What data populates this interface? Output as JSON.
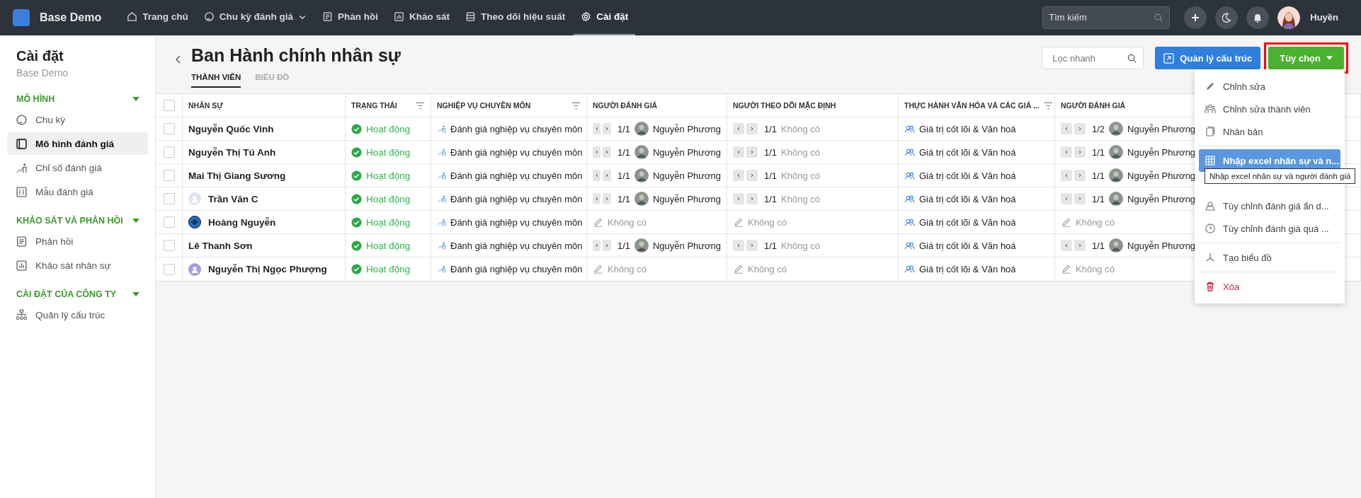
{
  "topbar": {
    "brand": "Base Demo",
    "nav": [
      {
        "label": "Trang chủ",
        "selected": false,
        "dropdown": false
      },
      {
        "label": "Chu kỳ đánh giá",
        "selected": false,
        "dropdown": true
      },
      {
        "label": "Phản hồi",
        "selected": false,
        "dropdown": false
      },
      {
        "label": "Khảo sát",
        "selected": false,
        "dropdown": false
      },
      {
        "label": "Theo dõi hiệu suất",
        "selected": false,
        "dropdown": false
      },
      {
        "label": "Cài đặt",
        "selected": true,
        "dropdown": false
      }
    ],
    "search": {
      "placeholder": "Tìm kiếm"
    },
    "user": "Huyền"
  },
  "sidebar": {
    "title": "Cài đặt",
    "subtitle": "Base Demo",
    "sections": [
      {
        "title": "MÔ HÌNH",
        "expanded": true,
        "items": [
          {
            "label": "Chu kỳ",
            "selected": false
          },
          {
            "label": "Mô hình đánh giá",
            "selected": true
          },
          {
            "label": "Chỉ số đánh giá",
            "selected": false
          },
          {
            "label": "Mẫu đánh giá",
            "selected": false
          }
        ]
      },
      {
        "title": "KHẢO SÁT VÀ PHẢN HỒI",
        "expanded": true,
        "items": [
          {
            "label": "Phản hồi",
            "selected": false
          },
          {
            "label": "Khảo sát nhân sự",
            "selected": false
          }
        ]
      },
      {
        "title": "CÀI ĐẶT CỦA CÔNG TY",
        "expanded": true,
        "items": [
          {
            "label": "Quản lý cấu trúc",
            "selected": false
          }
        ]
      }
    ]
  },
  "page": {
    "title": "Ban Hành chính nhân sự",
    "tabs": [
      {
        "label": "THÀNH VIÊN",
        "selected": true
      },
      {
        "label": "BIỂU ĐỒ",
        "selected": false
      }
    ],
    "filter": {
      "placeholder": "Lọc nhanh"
    },
    "structure_button": "Quản lý cấu trúc",
    "options_button": {
      "label": "Tùy chọn",
      "highlighted": true
    },
    "menu": [
      {
        "kind": "item",
        "label": "Chỉnh sửa",
        "selected": false
      },
      {
        "kind": "item",
        "label": "Chỉnh sửa thành viên",
        "selected": false
      },
      {
        "kind": "item",
        "label": "Nhân bản",
        "selected": false
      },
      {
        "kind": "divider"
      },
      {
        "kind": "item",
        "label": "Nhập excel nhân sự và n...",
        "selected": true
      },
      {
        "kind": "covered"
      },
      {
        "kind": "item",
        "label": "Tùy chỉnh đánh giá ẩn d...",
        "selected": false
      },
      {
        "kind": "item",
        "label": "Tùy chỉnh đánh giá quá ...",
        "selected": false
      },
      {
        "kind": "divider"
      },
      {
        "kind": "item",
        "label": "Tạo biểu đồ",
        "selected": false
      },
      {
        "kind": "divider"
      },
      {
        "kind": "danger",
        "label": "Xóa",
        "selected": false
      }
    ],
    "tooltip": "Nhập excel nhân sự và người đánh giá"
  },
  "table": {
    "all_checked": false,
    "columns": [
      {
        "label": "NHÂN SỰ",
        "filter": false
      },
      {
        "label": "TRẠNG THÁI",
        "filter": true
      },
      {
        "label": "NGHIỆP VỤ CHUYÊN MÔN",
        "filter": true
      },
      {
        "label": "NGƯỜI ĐÁNH GIÁ",
        "filter": false
      },
      {
        "label": "NGƯỜI THEO DÕI MẶC ĐỊNH",
        "filter": false
      },
      {
        "label": "THỰC HÀNH VĂN HÓA VÀ CÁC GIÁ ...",
        "filter": true
      },
      {
        "label": "NGƯỜI ĐÁNH GIÁ",
        "filter": false
      }
    ],
    "rows": [
      {
        "kind": "plain",
        "checked": false,
        "name": "Nguyễn Quốc Vinh",
        "status": "Hoạt động",
        "specialty": "Đánh giá nghiệp vụ chuyên môn",
        "evaluator": {
          "kind": "pager",
          "count": "1/1",
          "person": "Nguyễn Phương"
        },
        "follower": {
          "kind": "pager",
          "count": "1/1",
          "empty": "Không có"
        },
        "culture": "Giá trị cốt lõi & Văn hoá",
        "evaluator_2": {
          "kind": "pager",
          "count": "1/2",
          "person": "Nguyễn Phương"
        }
      },
      {
        "kind": "plain",
        "checked": false,
        "name": "Nguyễn Thị Tú Anh",
        "status": "Hoạt động",
        "specialty": "Đánh giá nghiệp vụ chuyên môn",
        "evaluator": {
          "kind": "pager",
          "count": "1/1",
          "person": "Nguyễn Phương"
        },
        "follower": {
          "kind": "pager",
          "count": "1/1",
          "empty": "Không có"
        },
        "culture": "Giá trị cốt lõi & Văn hoá",
        "evaluator_2": {
          "kind": "pager",
          "count": "1/1",
          "person": "Nguyễn Phương"
        }
      },
      {
        "kind": "plain",
        "checked": false,
        "name": "Mai Thị Giang Sương",
        "status": "Hoạt động",
        "specialty": "Đánh giá nghiệp vụ chuyên môn",
        "evaluator": {
          "kind": "pager",
          "count": "1/1",
          "person": "Nguyễn Phương"
        },
        "follower": {
          "kind": "pager",
          "count": "1/1",
          "empty": "Không có"
        },
        "culture": "Giá trị cốt lõi & Văn hoá",
        "evaluator_2": {
          "kind": "pager",
          "count": "1/1",
          "person": "Nguyễn Phương"
        }
      },
      {
        "kind": "faded",
        "checked": false,
        "name": "Trần Văn C",
        "status": "Hoạt động",
        "specialty": "Đánh giá nghiệp vụ chuyên môn",
        "evaluator": {
          "kind": "pager",
          "count": "1/1",
          "person": "Nguyễn Phương"
        },
        "follower": {
          "kind": "pager",
          "count": "1/1",
          "empty": "Không có"
        },
        "culture": "Giá trị cốt lõi & Văn hoá",
        "evaluator_2": {
          "kind": "pager",
          "count": "1/1",
          "person": "Nguyễn Phương"
        }
      },
      {
        "kind": "wave",
        "checked": false,
        "name": "Hoàng Nguyễn",
        "status": "Hoạt động",
        "specialty": "Đánh giá nghiệp vụ chuyên môn",
        "evaluator": {
          "kind": "empty",
          "empty": "Không có"
        },
        "follower": {
          "kind": "empty",
          "empty": "Không có"
        },
        "culture": "Giá trị cốt lõi & Văn hoá",
        "evaluator_2": {
          "kind": "empty",
          "empty": "Không có"
        }
      },
      {
        "kind": "plain",
        "checked": false,
        "name": "Lê Thanh Sơn",
        "status": "Hoạt động",
        "specialty": "Đánh giá nghiệp vụ chuyên môn",
        "evaluator": {
          "kind": "pager",
          "count": "1/1",
          "person": "Nguyễn Phương"
        },
        "follower": {
          "kind": "pager",
          "count": "1/1",
          "empty": "Không có"
        },
        "culture": "Giá trị cốt lõi & Văn hoá",
        "evaluator_2": {
          "kind": "pager",
          "count": "1/1",
          "person": "Nguyễn Phương"
        }
      },
      {
        "kind": "person",
        "checked": false,
        "name": "Nguyễn Thị Ngọc Phượng",
        "status": "Hoạt động",
        "specialty": "Đánh giá nghiệp vụ chuyên môn",
        "evaluator": {
          "kind": "empty",
          "empty": "Không có"
        },
        "follower": {
          "kind": "empty",
          "empty": "Không có"
        },
        "culture": "Giá trị cốt lõi & Văn hoá",
        "evaluator_2": {
          "kind": "empty",
          "empty": "Không có"
        }
      }
    ]
  }
}
